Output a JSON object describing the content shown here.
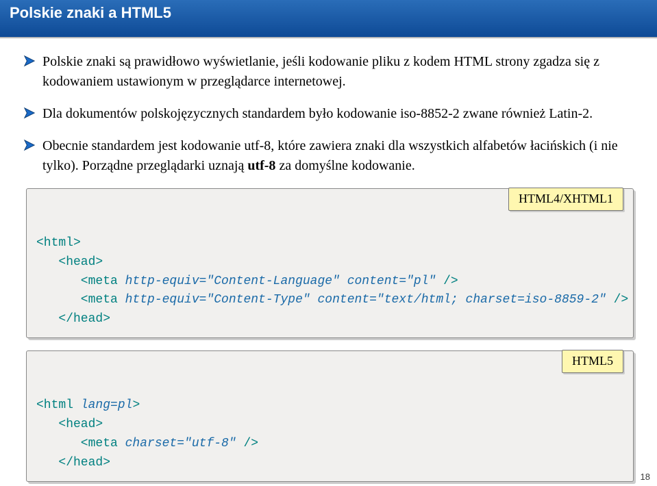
{
  "header": {
    "title": "Polskie znaki a HTML5"
  },
  "bullets": {
    "b1": "Polskie znaki są prawidłowo wyświetlanie, jeśli kodowanie pliku z kodem HTML strony zgadza się z kodowaniem ustawionym w przeglądarce internetowej.",
    "b2": "Dla dokumentów polskojęzycznych standardem było kodowanie iso-8852-2 zwane również Latin-2.",
    "b3a": "Obecnie standardem jest kodowanie utf-8, które zawiera znaki dla wszystkich alfabetów łacińskich (i nie tylko). Porządne przeglądarki uznają ",
    "b3bold": "utf-8",
    "b3b": " za domyślne kodowanie."
  },
  "code1": {
    "label": "HTML4/XHTML1",
    "l1a": "<html>",
    "l2a": "   <head>",
    "l3a": "      <meta ",
    "l3b": "http-equiv=\"Content-Language\"",
    "l3c": " ",
    "l3d": "content=\"pl\"",
    "l3e": " />",
    "l4a": "      <meta ",
    "l4b": "http-equiv=\"Content-Type\"",
    "l4c": " ",
    "l4d": "content=\"text/html; charset=iso-8859-2\"",
    "l4e": " />",
    "l5a": "   </head>"
  },
  "code2": {
    "label": "HTML5",
    "l1a": "<html ",
    "l1b": "lang=pl",
    "l1c": ">",
    "l2a": "   <head>",
    "l3a": "      <meta ",
    "l3b": "charset=\"utf-8\"",
    "l3c": " />",
    "l4a": "   </head>"
  },
  "page_number": "18"
}
